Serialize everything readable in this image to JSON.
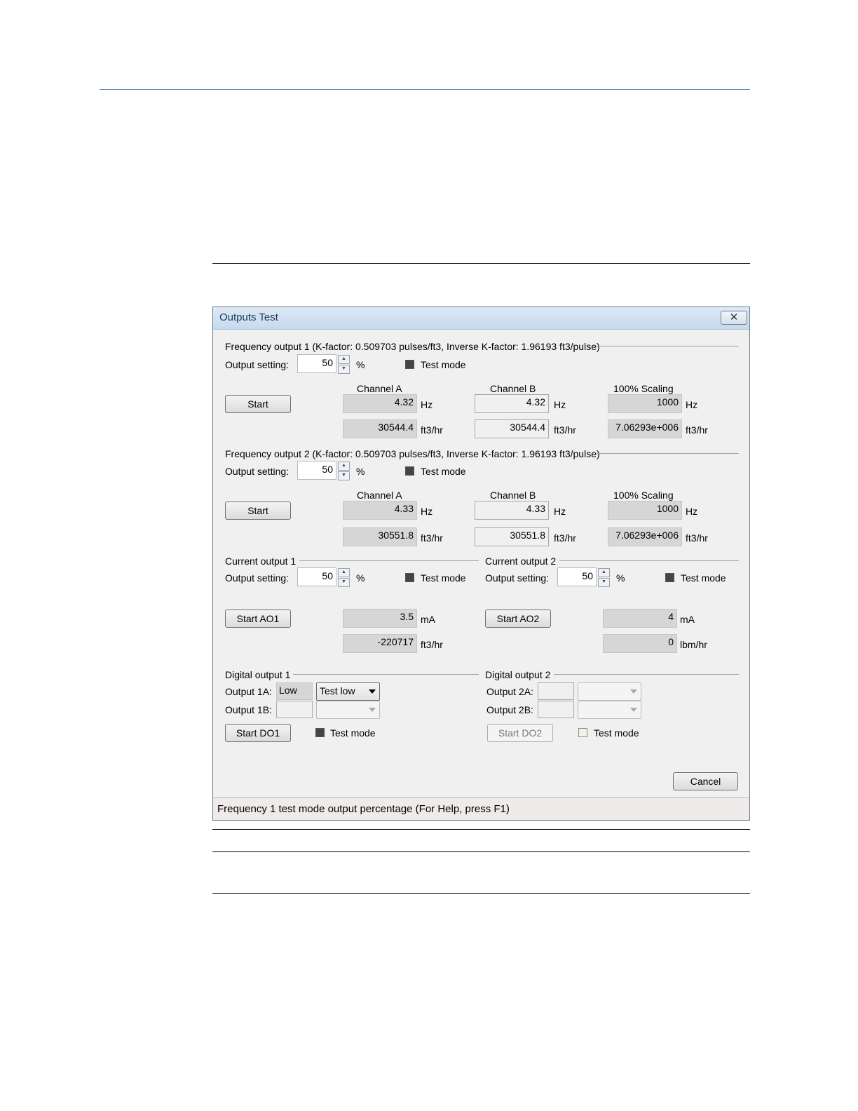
{
  "dialog": {
    "title": "Outputs Test",
    "close_symbol": "✕",
    "cancel_label": "Cancel",
    "status_text": "Frequency 1 test mode output percentage (For Help, press F1)"
  },
  "common": {
    "output_setting_label": "Output setting:",
    "percent": "%",
    "test_mode": "Test mode",
    "channel_a": "Channel A",
    "channel_b": "Channel B",
    "scaling": "100% Scaling",
    "hz": "Hz",
    "ft3hr": "ft3/hr",
    "ma": "mA",
    "lbmhr": "lbm/hr",
    "start": "Start"
  },
  "freq1": {
    "title": "Frequency output 1 (K-factor: 0.509703 pulses/ft3, Inverse K-factor: 1.96193 ft3/pulse)",
    "setting": "50",
    "a_hz": "4.32",
    "b_hz": "4.32",
    "s_hz": "1000",
    "a_flow": "30544.4",
    "b_flow": "30544.4",
    "s_flow": "7.06293e+006"
  },
  "freq2": {
    "title": "Frequency output 2 (K-factor: 0.509703 pulses/ft3, Inverse K-factor: 1.96193 ft3/pulse)",
    "setting": "50",
    "a_hz": "4.33",
    "b_hz": "4.33",
    "s_hz": "1000",
    "a_flow": "30551.8",
    "b_flow": "30551.8",
    "s_flow": "7.06293e+006"
  },
  "current1": {
    "title": "Current output 1",
    "setting": "50",
    "button": "Start AO1",
    "ma_value": "3.5",
    "flow_value": "-220717"
  },
  "current2": {
    "title": "Current output 2",
    "setting": "50",
    "button": "Start AO2",
    "ma_value": "4",
    "flow_value": "0"
  },
  "digital1": {
    "title": "Digital output 1",
    "label_a": "Output 1A:",
    "value_a": "Low",
    "select_a": "Test low",
    "label_b": "Output 1B:",
    "button": "Start DO1"
  },
  "digital2": {
    "title": "Digital output 2",
    "label_a": "Output 2A:",
    "label_b": "Output 2B:",
    "button": "Start DO2"
  }
}
